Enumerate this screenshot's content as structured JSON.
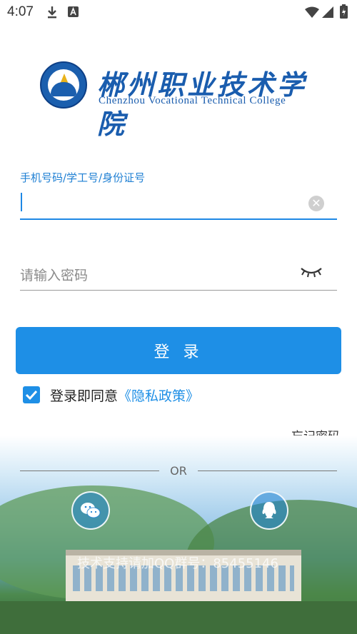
{
  "status_bar": {
    "time": "4:07",
    "icons": [
      "download-icon",
      "a-icon",
      "wifi-icon",
      "cellular-icon",
      "battery-icon"
    ]
  },
  "logo": {
    "name_cn": "郴州职业技术学院",
    "name_en": "Chenzhou Vocational Technical College"
  },
  "form": {
    "account_label": "手机号码/学工号/身份证号",
    "account_value": "",
    "password_placeholder": "请输入密码"
  },
  "login_button": "登 录",
  "agreement": {
    "checked": true,
    "text": "登录即同意",
    "link": "《隐私政策》"
  },
  "forgot_password": "忘记密码",
  "divider": "OR",
  "social": [
    "wechat-icon",
    "qq-icon"
  ],
  "watermark": "技术支持请加QQ群号：85455146",
  "colors": {
    "accent": "#1e8fe6",
    "label": "#1e7fd3",
    "brand": "#1a5dae"
  }
}
